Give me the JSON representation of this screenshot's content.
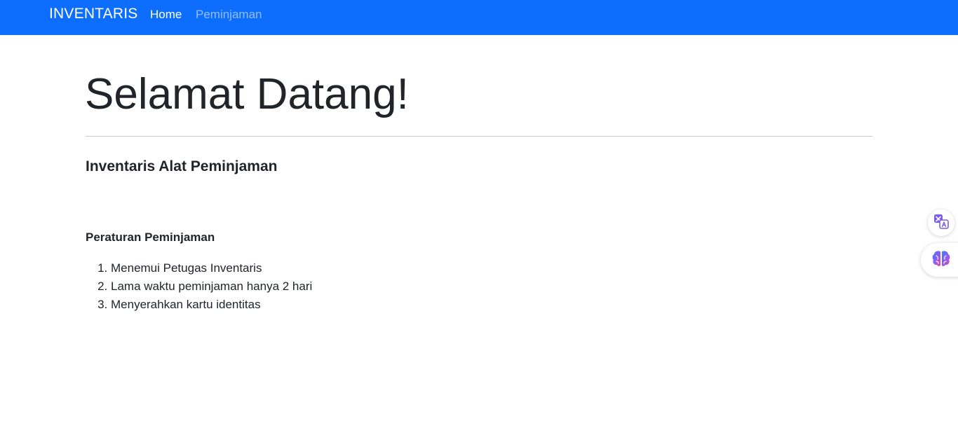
{
  "navbar": {
    "brand": "INVENTARIS",
    "links": [
      {
        "label": "Home",
        "active": true
      },
      {
        "label": "Peminjaman",
        "active": false
      }
    ],
    "background_color": "#0d6efd"
  },
  "main": {
    "title": "Selamat Datang!",
    "subtitle": "Inventaris Alat Peminjaman",
    "rules_title": "Peraturan Peminjaman",
    "rules": [
      "Menemui Petugas Inventaris",
      "Lama waktu peminjaman hanya 2 hari",
      "Menyerahkan kartu identitas"
    ]
  },
  "floating_buttons": {
    "translate_icon": "translate-icon",
    "ai_icon": "brain-icon"
  }
}
